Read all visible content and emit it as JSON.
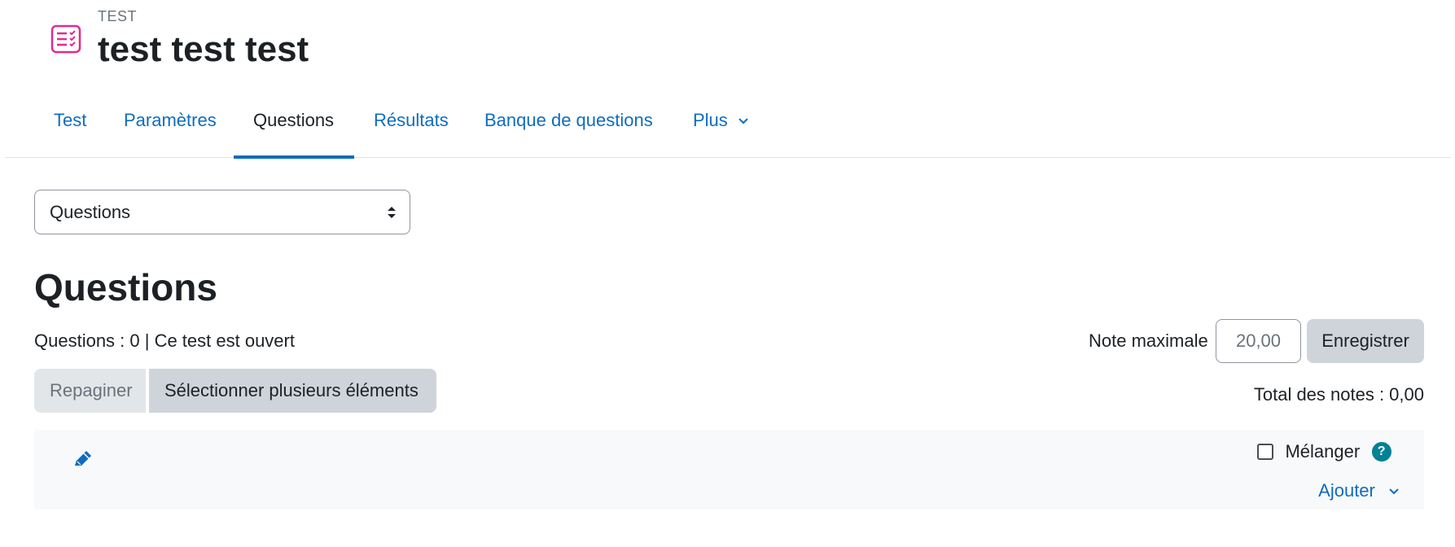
{
  "header": {
    "activity_type": "TEST",
    "title": "test test test"
  },
  "tabs": [
    {
      "label": "Test"
    },
    {
      "label": "Paramètres"
    },
    {
      "label": "Questions"
    },
    {
      "label": "Résultats"
    },
    {
      "label": "Banque de questions"
    },
    {
      "label": "Plus"
    }
  ],
  "tertiary_nav": {
    "selected": "Questions"
  },
  "main": {
    "title": "Questions",
    "status": "Questions : 0 | Ce test est ouvert",
    "repaginate_label": "Repaginer",
    "select_multiple_label": "Sélectionner plusieurs éléments",
    "max_grade_label": "Note maximale",
    "max_grade_value": "20,00",
    "save_label": "Enregistrer",
    "total_marks": "Total des notes : 0,00"
  },
  "section": {
    "shuffle_label": "Mélanger",
    "help_symbol": "?",
    "add_label": "Ajouter"
  },
  "colors": {
    "accent": "#0f6cbf",
    "icon_pink": "#e32b8f",
    "help_teal": "#008196"
  }
}
